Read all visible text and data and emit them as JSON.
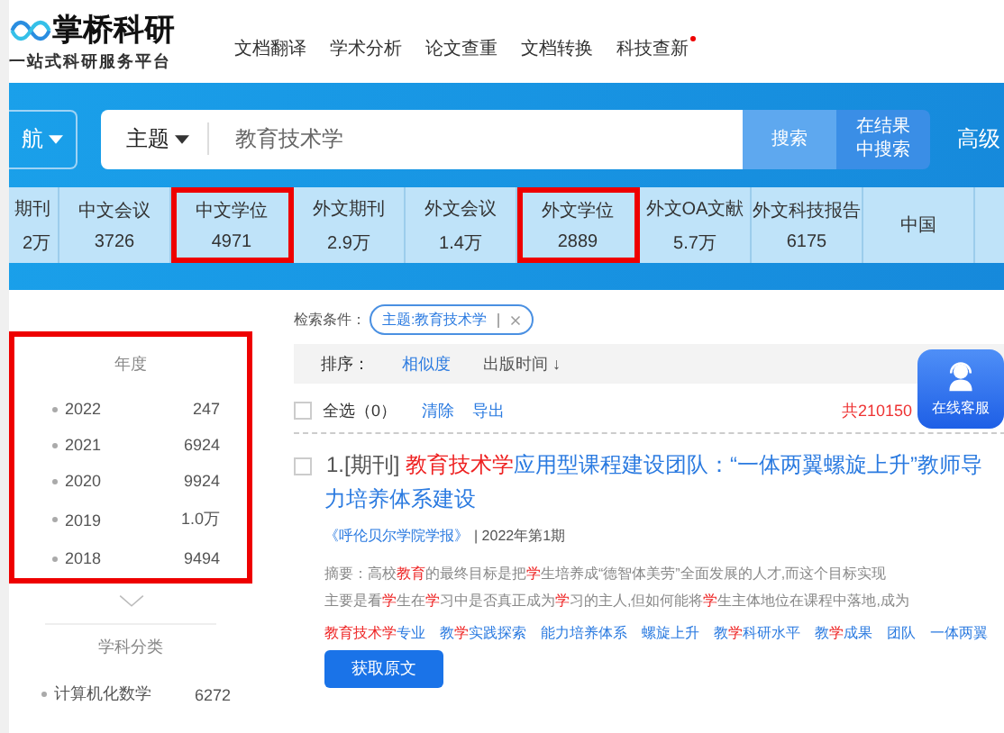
{
  "logo": {
    "name": "掌桥科研",
    "slogan": "一站式科研服务平台"
  },
  "nav": [
    {
      "label": "文档翻译",
      "dot": false
    },
    {
      "label": "学术分析",
      "dot": false
    },
    {
      "label": "论文查重",
      "dot": false
    },
    {
      "label": "文档转换",
      "dot": false
    },
    {
      "label": "科技查新",
      "dot": true
    }
  ],
  "search": {
    "nav_button": "航",
    "field_select": "主题",
    "value": "教育技术学",
    "search_button": "搜索",
    "within_button": "在结果中搜索",
    "advanced": "高级"
  },
  "tabs": [
    {
      "label": "期刊",
      "count": "2万",
      "highlighted": false
    },
    {
      "label": "中文会议",
      "count": "3726",
      "highlighted": false
    },
    {
      "label": "中文学位",
      "count": "4971",
      "highlighted": true
    },
    {
      "label": "外文期刊",
      "count": "2.9万",
      "highlighted": false
    },
    {
      "label": "外文会议",
      "count": "1.4万",
      "highlighted": false
    },
    {
      "label": "外文学位",
      "count": "2889",
      "highlighted": true
    },
    {
      "label": "外文OA文献",
      "count": "5.7万",
      "highlighted": false
    },
    {
      "label": "外文科技报告",
      "count": "6175",
      "highlighted": false
    },
    {
      "label": "中国",
      "highlighted": false
    }
  ],
  "sidebar": {
    "year_title": "年度",
    "year_highlighted": true,
    "years": [
      {
        "label": "2022",
        "count": "247"
      },
      {
        "label": "2021",
        "count": "6924"
      },
      {
        "label": "2020",
        "count": "9924"
      },
      {
        "label": "2019",
        "count": "1.0万"
      },
      {
        "label": "2018",
        "count": "9494"
      }
    ],
    "subject_title": "学科分类",
    "subjects": [
      {
        "label": "计算机化数学",
        "count": "6272"
      }
    ]
  },
  "conditions": {
    "label": "检索条件：",
    "tag": "主题:教育技术学"
  },
  "sort": {
    "label": "排序：",
    "options": [
      {
        "label": "相似度",
        "selected": true
      },
      {
        "label": "出版时间 ↓",
        "selected": false
      }
    ]
  },
  "select_bar": {
    "select_all": "全选（0）",
    "checked": false,
    "clear": "清除",
    "export": "导出",
    "total": "共210150"
  },
  "results": [
    {
      "checked": false,
      "prefix": "1.[期刊] ",
      "title": [
        {
          "t": "教育技术学",
          "hl": true
        },
        {
          "t": "应用型课程建设团队：“一体两翼螺旋上升”教师导",
          "hl": false
        }
      ],
      "title_line2": "力培养体系建设",
      "source": "《呼伦贝尔学院学报》",
      "issue": "| 2022年第1期",
      "abstract": [
        [
          {
            "t": "摘要：高校",
            "hl": false
          },
          {
            "t": "教育",
            "hl": true
          },
          {
            "t": "的最终目标是把",
            "hl": false
          },
          {
            "t": "学",
            "hl": true
          },
          {
            "t": "生培养成“德智体美劳”全面发展的人才,而这个目标实现",
            "hl": false
          }
        ],
        [
          {
            "t": "主要是看",
            "hl": false
          },
          {
            "t": "学",
            "hl": true
          },
          {
            "t": "生在",
            "hl": false
          },
          {
            "t": "学",
            "hl": true
          },
          {
            "t": "习中是否真正成为",
            "hl": false
          },
          {
            "t": "学",
            "hl": true
          },
          {
            "t": "习的主人,但如何能将",
            "hl": false
          },
          {
            "t": "学",
            "hl": true
          },
          {
            "t": "生主体地位在课程中落地,成为",
            "hl": false
          }
        ]
      ],
      "keywords": [
        [
          {
            "t": "教育技术学",
            "hl": true
          },
          {
            "t": "专业",
            "hl": false
          }
        ],
        [
          {
            "t": "教",
            "hl": false
          },
          {
            "t": "学",
            "hl": true
          },
          {
            "t": "实践探索",
            "hl": false
          }
        ],
        [
          {
            "t": "能力培养体系",
            "hl": false
          }
        ],
        [
          {
            "t": "螺旋上升",
            "hl": false
          }
        ],
        [
          {
            "t": "教",
            "hl": false
          },
          {
            "t": "学",
            "hl": true
          },
          {
            "t": "科研水平",
            "hl": false
          }
        ],
        [
          {
            "t": "教",
            "hl": false
          },
          {
            "t": "学",
            "hl": true
          },
          {
            "t": "成果",
            "hl": false
          }
        ],
        [
          {
            "t": "团队",
            "hl": false
          }
        ],
        [
          {
            "t": "一体两翼",
            "hl": false
          }
        ]
      ],
      "action": "获取原文"
    }
  ],
  "float_service": "在线客服"
}
